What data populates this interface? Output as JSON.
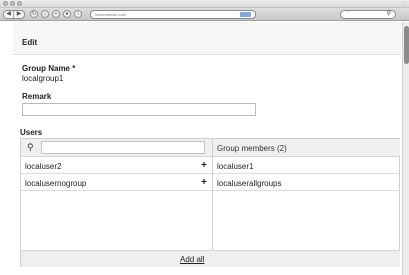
{
  "browser": {
    "url": "www.domain.com",
    "nav_buttons": [
      "◀",
      "▶"
    ]
  },
  "page": {
    "title": "Edit",
    "group_name_label": "Group Name *",
    "group_name_value": "localgroup1",
    "remark_label": "Remark",
    "remark_value": "",
    "users_label": "Users"
  },
  "users": {
    "available": [
      {
        "name": "localuser2",
        "action": "+"
      },
      {
        "name": "localusernogroup",
        "action": "+"
      }
    ],
    "members_header": "Group members  (2)",
    "members": [
      {
        "name": "localuser1"
      },
      {
        "name": "localuserallgroups"
      }
    ],
    "add_all_label": "Add all"
  },
  "colors": {
    "header_bg": "#f6f6f6",
    "panel_bg": "#efefef",
    "border": "#cfcfcf"
  }
}
